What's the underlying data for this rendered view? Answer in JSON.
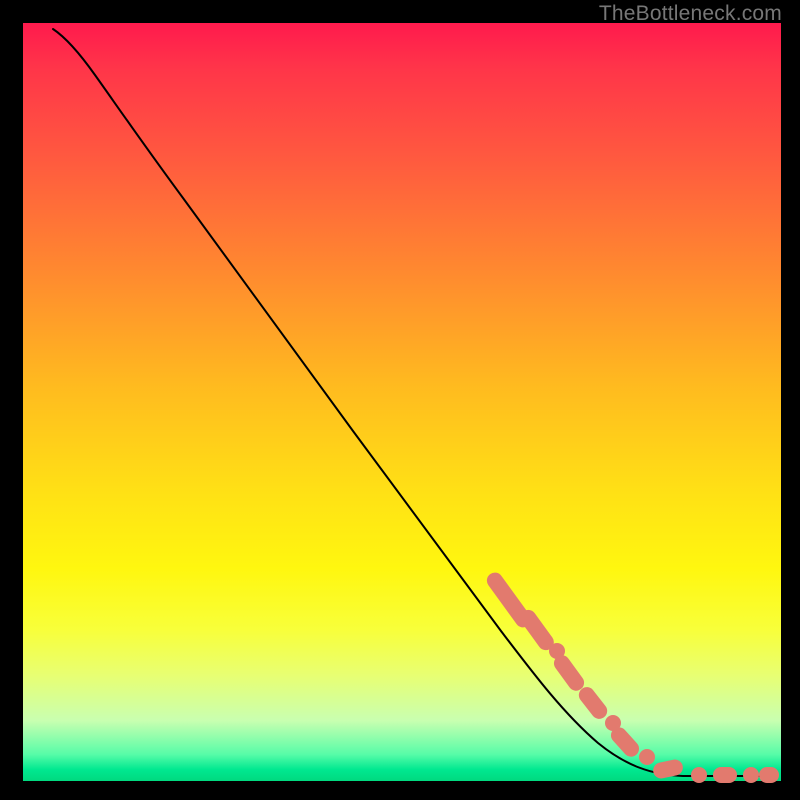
{
  "watermark": "TheBottleneck.com",
  "colors": {
    "background": "#000000",
    "line": "#000000",
    "marker": "#e27a6e"
  },
  "chart_data": {
    "type": "line",
    "title": "",
    "xlabel": "",
    "ylabel": "",
    "xlim": [
      0,
      100
    ],
    "ylim": [
      0,
      100
    ],
    "grid": false,
    "legend": false,
    "notes": "Axes are unlabeled in the source image. Values are normalized 0–100 in both dimensions, estimated from pixel positions. The plotted curve starts near the top-left, descends roughly linearly, and flattens to ~0 near the right edge. A cluster of salmon-colored markers lies along the lower-right portion of the curve.",
    "series": [
      {
        "name": "curve",
        "x": [
          4.0,
          6.5,
          9.0,
          12.0,
          16.0,
          22.0,
          30.0,
          40.0,
          50.0,
          58.0,
          64.0,
          68.0,
          72.0,
          75.5,
          78.0,
          80.0,
          82.0,
          84.0,
          86.0,
          88.0,
          91.0,
          95.0,
          99.0
        ],
        "y": [
          99.0,
          97.5,
          95.0,
          91.5,
          86.5,
          79.0,
          69.0,
          56.5,
          44.0,
          34.0,
          26.5,
          21.5,
          16.5,
          12.0,
          9.0,
          6.5,
          4.5,
          3.0,
          1.8,
          1.0,
          0.6,
          0.5,
          0.5
        ]
      }
    ],
    "markers": {
      "name": "highlighted-segment",
      "points_xy": [
        [
          64.0,
          26.5
        ],
        [
          66.0,
          24.0
        ],
        [
          68.0,
          21.5
        ],
        [
          69.5,
          19.5
        ],
        [
          71.0,
          17.5
        ],
        [
          72.5,
          15.5
        ],
        [
          74.0,
          13.5
        ],
        [
          75.5,
          12.0
        ],
        [
          77.0,
          10.0
        ],
        [
          78.0,
          9.0
        ],
        [
          79.0,
          7.8
        ],
        [
          81.0,
          5.5
        ],
        [
          82.0,
          4.5
        ],
        [
          83.0,
          3.5
        ],
        [
          85.0,
          2.2
        ],
        [
          88.0,
          1.0
        ],
        [
          90.0,
          0.8
        ],
        [
          93.0,
          0.6
        ],
        [
          96.0,
          0.5
        ],
        [
          99.0,
          0.5
        ]
      ]
    }
  }
}
